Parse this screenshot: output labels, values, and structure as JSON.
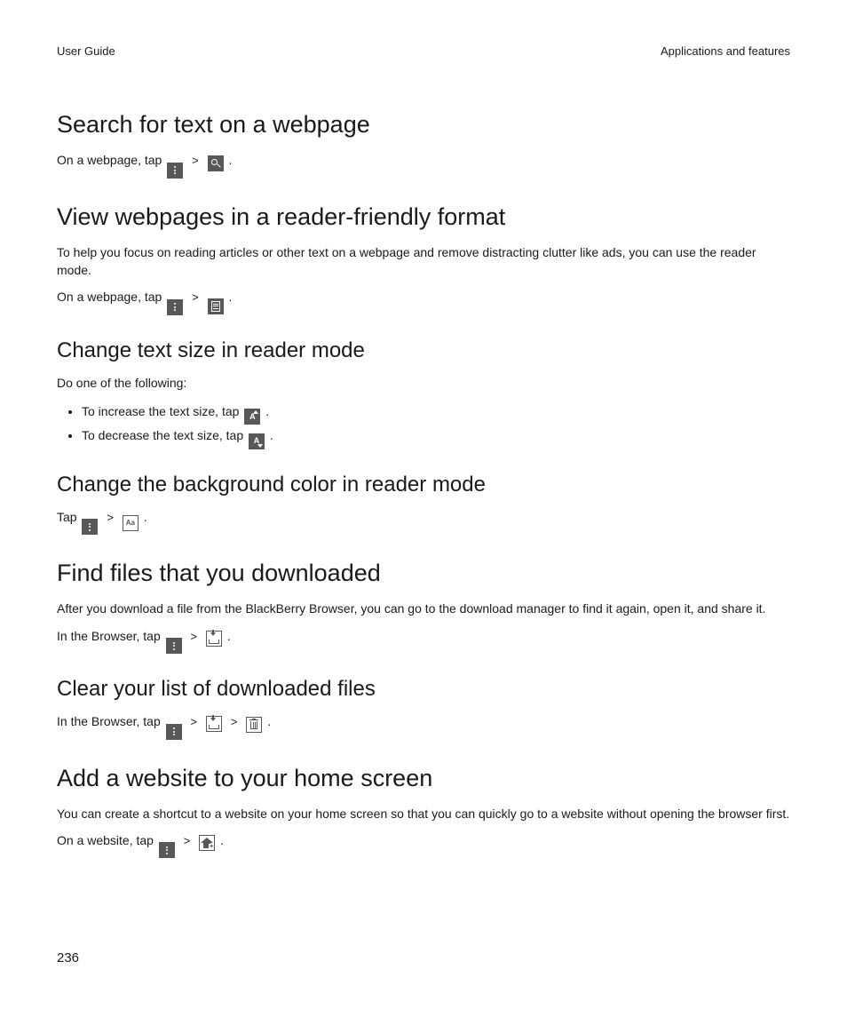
{
  "header": {
    "left": "User Guide",
    "right": "Applications and features"
  },
  "sections": {
    "search": {
      "heading": "Search for text on a webpage",
      "line_pre": "On a webpage, tap",
      "line_post": "."
    },
    "reader_view": {
      "heading": "View webpages in a reader-friendly format",
      "body": "To help you focus on reading articles or other text on a webpage and remove distracting clutter like ads, you can use the reader mode.",
      "line_pre": "On a webpage, tap",
      "line_post": "."
    },
    "text_size": {
      "heading": "Change text size in reader mode",
      "body": "Do one of the following:",
      "bullet1_pre": "To increase the text size, tap",
      "bullet1_post": ".",
      "bullet2_pre": "To decrease the text size, tap",
      "bullet2_post": "."
    },
    "bg_color": {
      "heading": "Change the background color in reader mode",
      "line_pre": "Tap",
      "line_post": "."
    },
    "find_files": {
      "heading": "Find files that you downloaded",
      "body": "After you download a file from the BlackBerry Browser, you can go to the download manager to find it again, open it, and share it.",
      "line_pre": "In the Browser, tap",
      "line_post": "."
    },
    "clear_list": {
      "heading": "Clear your list of downloaded files",
      "line_pre": "In the Browser, tap",
      "line_post": "."
    },
    "add_home": {
      "heading": "Add a website to your home screen",
      "body": "You can create a shortcut to a website on your home screen so that you can quickly go to a website without opening the browser first.",
      "line_pre": "On a website, tap",
      "line_post": "."
    }
  },
  "arrow": ">",
  "page_number": "236"
}
